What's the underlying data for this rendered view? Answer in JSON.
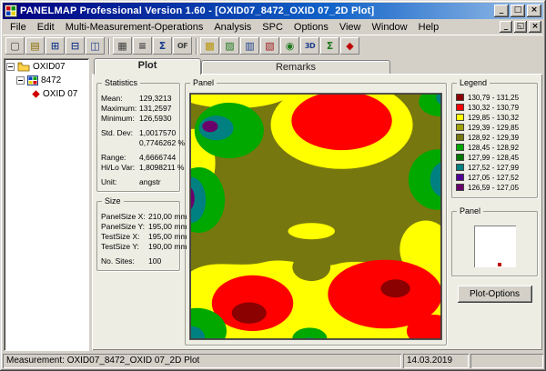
{
  "window": {
    "title": "PANELMAP  Professional Version 1.60 - [OXID07_8472_OXID 07_2D Plot]",
    "status_left": "Measurement: OXID07_8472_OXID 07_2D Plot",
    "status_date": "14.03.2019"
  },
  "icons": {
    "minimize": "_",
    "maximize": "□",
    "restore": "◱",
    "close": "×"
  },
  "menu": {
    "items": [
      "File",
      "Edit",
      "Multi-Measurement-Operations",
      "Analysis",
      "SPC",
      "Options",
      "View",
      "Window",
      "Help"
    ]
  },
  "toolbar": {
    "buttons": [
      {
        "name": "new-document",
        "glyph": "▢",
        "color": "#404040"
      },
      {
        "name": "open-folder",
        "glyph": "▤",
        "color": "#8a6d00"
      },
      {
        "name": "new-window",
        "glyph": "⊞",
        "color": "#1a3c8c"
      },
      {
        "name": "tile-windows",
        "glyph": "⊟",
        "color": "#1a3c8c"
      },
      {
        "name": "copy-view",
        "glyph": "◫",
        "color": "#1a3c8c"
      },
      {
        "name": "data-table",
        "glyph": "▦",
        "color": "#404040"
      },
      {
        "name": "value-list",
        "glyph": "≡",
        "color": "#404040"
      },
      {
        "name": "sum-table",
        "glyph": "Σ",
        "color": "#1a3c8c"
      },
      {
        "name": "of-view",
        "glyph": "OF",
        "color": "#404040"
      },
      {
        "name": "color-map",
        "glyph": "▩",
        "color": "#b8960a"
      },
      {
        "name": "surface-plot",
        "glyph": "▨",
        "color": "#1f7a1f"
      },
      {
        "name": "bar-chart",
        "glyph": "▥",
        "color": "#1a3c8c"
      },
      {
        "name": "multi-plot",
        "glyph": "▧",
        "color": "#a02020"
      },
      {
        "name": "target-view",
        "glyph": "◉",
        "color": "#1f7a1f"
      },
      {
        "name": "view-3d",
        "glyph": "3D",
        "color": "#1a3c8c"
      },
      {
        "name": "sigma-chart",
        "glyph": "Σ",
        "color": "#1f7a1f"
      },
      {
        "name": "trend-chart",
        "glyph": "◆",
        "color": "#c00000"
      }
    ]
  },
  "tree": {
    "root": "OXID07",
    "child": "8472",
    "leaf": "OXID 07"
  },
  "tabs": {
    "plot": "Plot",
    "remarks": "Remarks"
  },
  "statistics": {
    "title": "Statistics",
    "rows": [
      {
        "label": "Mean:",
        "value": "129,3213"
      },
      {
        "label": "Maximum:",
        "value": "131,2597"
      },
      {
        "label": "Minimum:",
        "value": "126,5930"
      },
      {
        "label": "Std. Dev:",
        "value": "1,0017570"
      },
      {
        "label": "",
        "value": "0,7746262 %"
      },
      {
        "label": "Range:",
        "value": "4,6666744"
      },
      {
        "label": "Hi/Lo Var:",
        "value": "1,8098211 %"
      },
      {
        "label": "Unit:",
        "value": "angstr"
      }
    ]
  },
  "size": {
    "title": "Size",
    "rows": [
      {
        "label": "PanelSize X:",
        "value": "210,00 mm"
      },
      {
        "label": "PanelSize Y:",
        "value": "195,00 mm"
      },
      {
        "label": "TestSize X:",
        "value": "195,00 mm"
      },
      {
        "label": "TestSize Y:",
        "value": "190,00 mm"
      },
      {
        "label": "No. Sites:",
        "value": "100"
      }
    ]
  },
  "panel_group": {
    "title": "Panel"
  },
  "legend": {
    "title": "Legend",
    "entries": [
      {
        "range": "130,79 - 131,25",
        "color": "#8b0000"
      },
      {
        "range": "130,32 - 130,79",
        "color": "#ff0000"
      },
      {
        "range": "129,85 - 130,32",
        "color": "#ffff00"
      },
      {
        "range": "129,39 - 129,85",
        "color": "#a0a000"
      },
      {
        "range": "128,92 - 129,39",
        "color": "#77770f"
      },
      {
        "range": "128,45 - 128,92",
        "color": "#00a800"
      },
      {
        "range": "127,99 - 128,45",
        "color": "#007800"
      },
      {
        "range": "127,52 - 127,99",
        "color": "#008080"
      },
      {
        "range": "127,05 - 127,52",
        "color": "#500096"
      },
      {
        "range": "126,59 - 127,05",
        "color": "#6a006a"
      }
    ]
  },
  "minimap": {
    "title": "Panel"
  },
  "plot_options_label": "Plot-Options",
  "plot": {
    "colors": {
      "olive": "#77770f",
      "yellow": "#ffff00",
      "red": "#ff0000",
      "dark_red": "#8b0000",
      "green": "#00a800",
      "teal": "#008080",
      "purple": "#6a006a"
    }
  }
}
